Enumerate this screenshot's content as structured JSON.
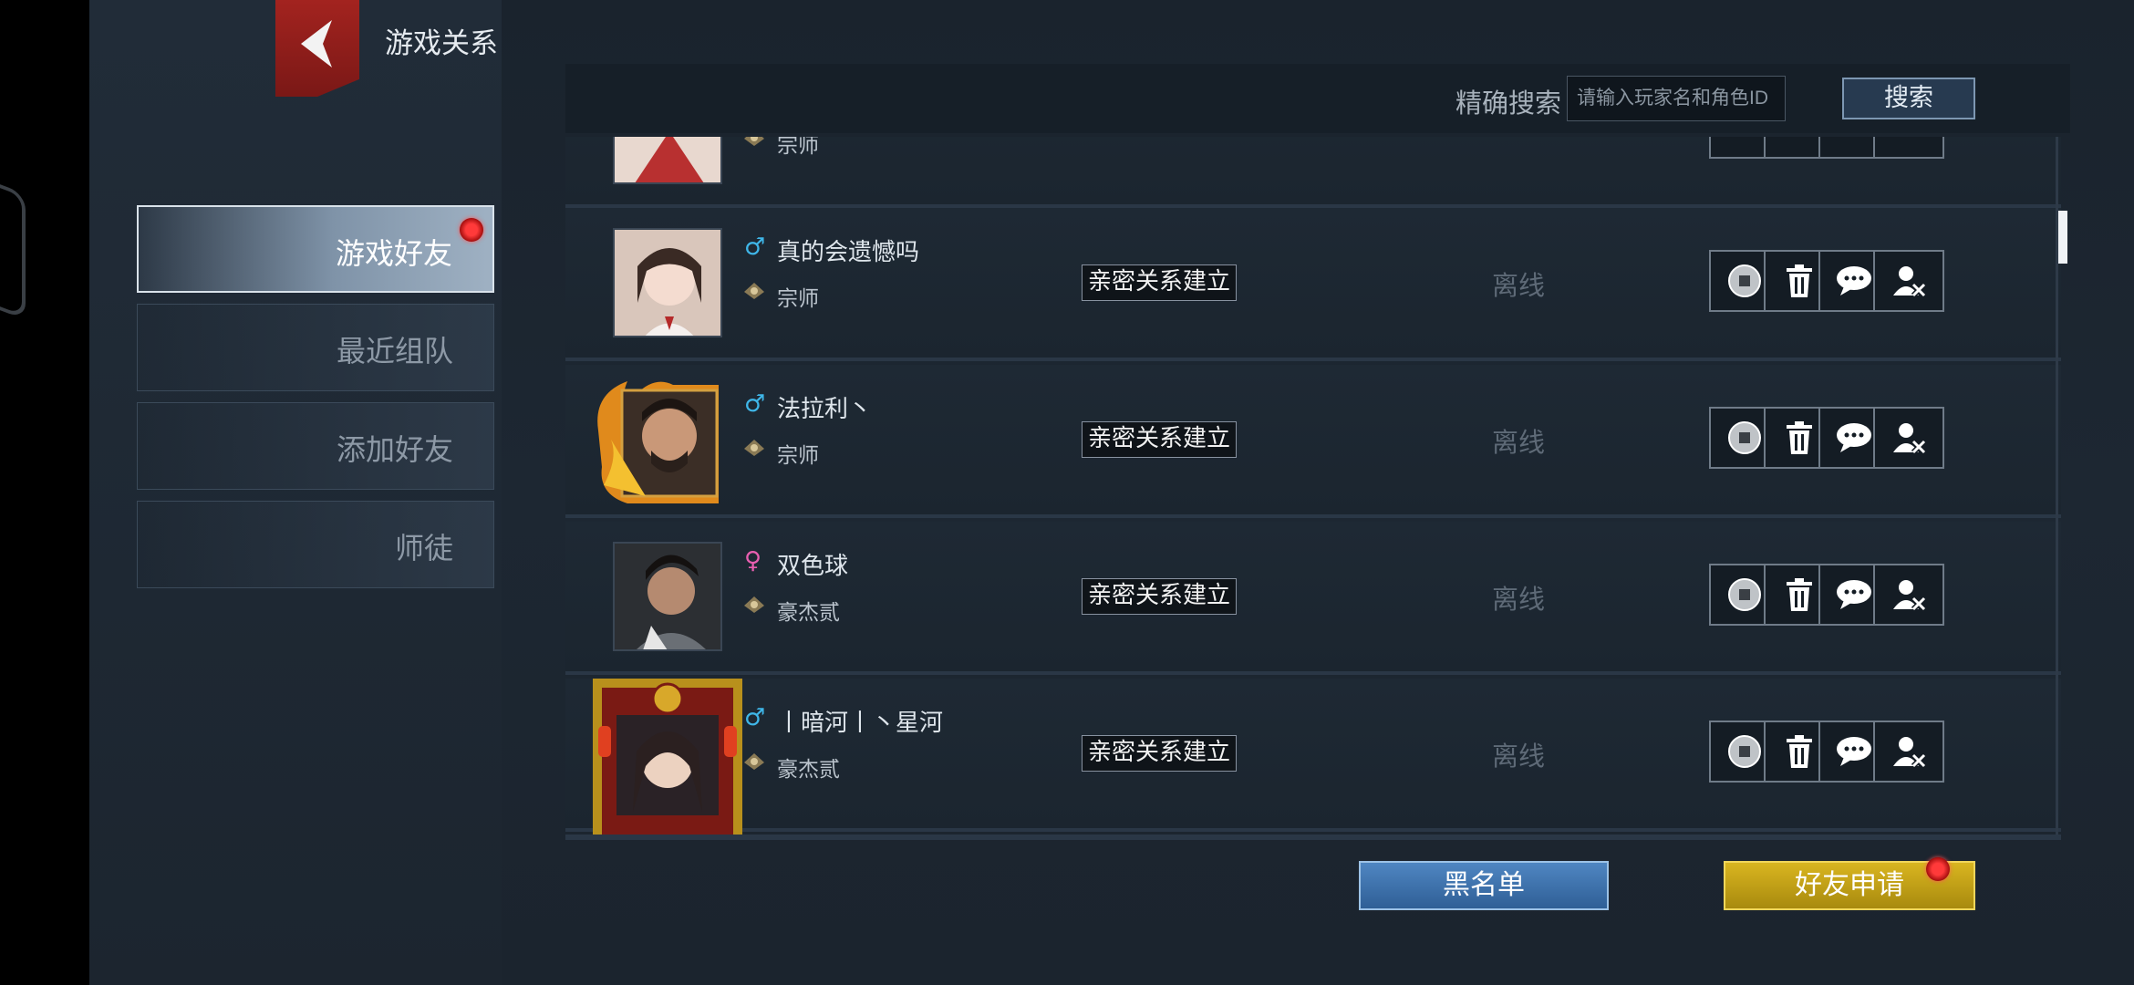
{
  "header": {
    "title": "游戏关系"
  },
  "nav": [
    {
      "label": "游戏好友",
      "active": true,
      "badge": true
    },
    {
      "label": "最近组队",
      "active": false
    },
    {
      "label": "添加好友",
      "active": false
    },
    {
      "label": "师徒",
      "active": false
    }
  ],
  "search": {
    "label": "精确搜索",
    "placeholder": "请输入玩家名和角色ID",
    "button": "搜索"
  },
  "friends": [
    {
      "name": "",
      "rank": "宗师",
      "gender": "male",
      "intimacy": "",
      "status": ""
    },
    {
      "name": "真的会遗憾吗",
      "rank": "宗师",
      "gender": "male",
      "intimacy": "亲密关系建立",
      "status": "离线"
    },
    {
      "name": "法拉利丶",
      "rank": "宗师",
      "gender": "male",
      "intimacy": "亲密关系建立",
      "status": "离线"
    },
    {
      "name": "双色球",
      "rank": "豪杰贰",
      "gender": "female",
      "intimacy": "亲密关系建立",
      "status": "离线"
    },
    {
      "name": "丨暗河丨丶星河",
      "rank": "豪杰贰",
      "gender": "male",
      "intimacy": "亲密关系建立",
      "status": "离线"
    }
  ],
  "gender_symbols": {
    "male": "♂",
    "female": "♀"
  },
  "colors": {
    "male": "#3fb6e8",
    "female": "#e85fb0",
    "accent_red": "#a3231f",
    "blacklist": "#3d73b0",
    "request": "#c7a516"
  },
  "actions": [
    "coin-icon",
    "delete-icon",
    "chat-icon",
    "remove-friend-icon"
  ],
  "footer": {
    "blacklist": "黑名单",
    "friend_request": "好友申请"
  }
}
